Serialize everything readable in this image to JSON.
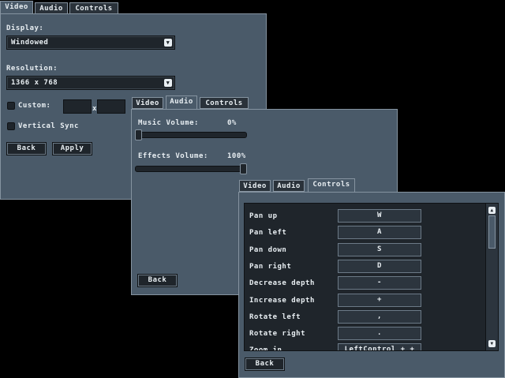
{
  "windows": {
    "video": {
      "tabs": [
        "Video",
        "Audio",
        "Controls"
      ],
      "display_label": "Display:",
      "display_value": "Windowed",
      "resolution_label": "Resolution:",
      "resolution_value": "1366 x 768",
      "custom_label": "Custom:",
      "custom_separator": "x",
      "custom_width": "",
      "custom_height": "",
      "vsync_label": "Vertical Sync",
      "back_label": "Back",
      "apply_label": "Apply"
    },
    "audio": {
      "tabs": [
        "Video",
        "Audio",
        "Controls"
      ],
      "music_label": "Music Volume:",
      "music_value": "0%",
      "music_level": 0.0,
      "effects_label": "Effects Volume:",
      "effects_value": "100%",
      "effects_level": 1.0,
      "back_label": "Back"
    },
    "controls": {
      "tabs": [
        "Video",
        "Audio",
        "Controls"
      ],
      "bindings": [
        {
          "action": "Pan up",
          "key": "W"
        },
        {
          "action": "Pan left",
          "key": "A"
        },
        {
          "action": "Pan down",
          "key": "S"
        },
        {
          "action": "Pan right",
          "key": "D"
        },
        {
          "action": "Decrease depth",
          "key": "-"
        },
        {
          "action": "Increase depth",
          "key": "+"
        },
        {
          "action": "Rotate left",
          "key": ","
        },
        {
          "action": "Rotate right",
          "key": "."
        },
        {
          "action": "Zoom in",
          "key": "LeftControl + +"
        }
      ],
      "back_label": "Back"
    }
  },
  "icons": {
    "dropdown_arrow": "▼",
    "scroll_up": "▲",
    "scroll_down": "▼"
  }
}
